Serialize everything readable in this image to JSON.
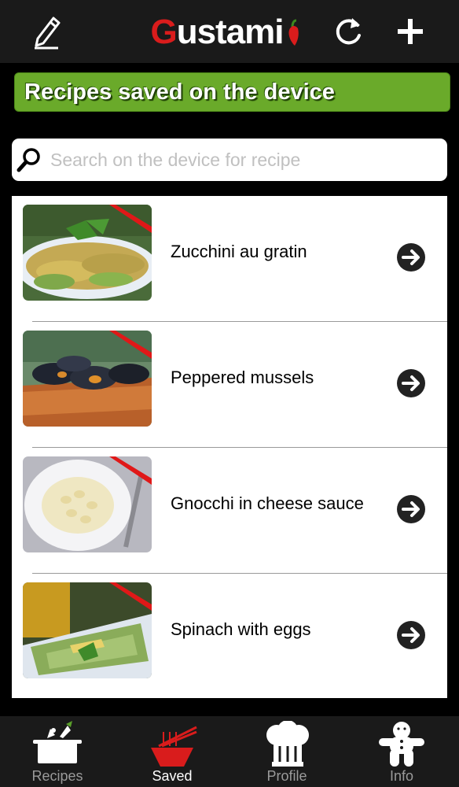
{
  "header": {
    "brand_first": "G",
    "brand_rest": "ustami",
    "edit_icon": "pencil-icon",
    "refresh_icon": "refresh-icon",
    "add_icon": "plus-icon",
    "brand_color": "#d91c1c"
  },
  "banner": {
    "title": "Recipes saved on the device",
    "color": "#6aaa2a"
  },
  "search": {
    "placeholder": "Search on the device for recipe",
    "value": ""
  },
  "recipes": [
    {
      "name": "Zucchini au gratin"
    },
    {
      "name": "Peppered mussels"
    },
    {
      "name": "Gnocchi in cheese sauce"
    },
    {
      "name": "Spinach with eggs"
    }
  ],
  "tabs": [
    {
      "label": "Recipes",
      "icon": "cooking-pot-icon",
      "active": false
    },
    {
      "label": "Saved",
      "icon": "saved-bowl-icon",
      "active": true
    },
    {
      "label": "Profile",
      "icon": "chef-hat-icon",
      "active": false
    },
    {
      "label": "Info",
      "icon": "gingerbread-man-icon",
      "active": false
    }
  ]
}
